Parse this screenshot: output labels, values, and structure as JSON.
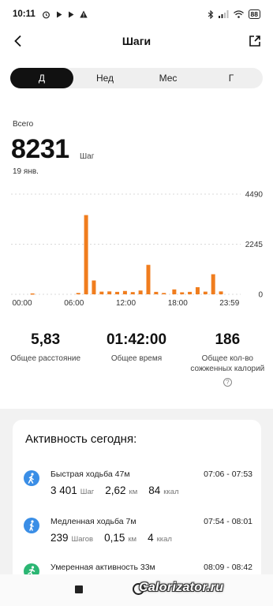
{
  "status_bar": {
    "time": "10:11",
    "battery": "88"
  },
  "header": {
    "title": "Шаги"
  },
  "tabs": [
    {
      "label": "Д",
      "active": true
    },
    {
      "label": "Нед",
      "active": false
    },
    {
      "label": "Мес",
      "active": false
    },
    {
      "label": "Г",
      "active": false
    }
  ],
  "summary": {
    "label": "Всего",
    "value": "8231",
    "unit": "Шаг",
    "date": "19 янв."
  },
  "chart_data": {
    "type": "bar",
    "x_ticks": [
      "00:00",
      "06:00",
      "12:00",
      "18:00",
      "23:59"
    ],
    "y_ticks": [
      "4490",
      "2245",
      "0"
    ],
    "ylim": [
      0,
      4490
    ],
    "bar_color": "#f07d1e",
    "bars": [
      {
        "hour": 1.2,
        "value": 40
      },
      {
        "hour": 6.5,
        "value": 60
      },
      {
        "hour": 7.4,
        "value": 3550
      },
      {
        "hour": 8.3,
        "value": 620
      },
      {
        "hour": 9.2,
        "value": 120
      },
      {
        "hour": 10.1,
        "value": 130
      },
      {
        "hour": 11.0,
        "value": 110
      },
      {
        "hour": 11.9,
        "value": 150
      },
      {
        "hour": 12.8,
        "value": 100
      },
      {
        "hour": 13.7,
        "value": 170
      },
      {
        "hour": 14.6,
        "value": 1320
      },
      {
        "hour": 15.5,
        "value": 110
      },
      {
        "hour": 16.4,
        "value": 60
      },
      {
        "hour": 17.6,
        "value": 220
      },
      {
        "hour": 18.5,
        "value": 90
      },
      {
        "hour": 19.4,
        "value": 110
      },
      {
        "hour": 20.3,
        "value": 320
      },
      {
        "hour": 21.2,
        "value": 120
      },
      {
        "hour": 22.1,
        "value": 900
      },
      {
        "hour": 23.0,
        "value": 130
      }
    ]
  },
  "stats": [
    {
      "value": "5,83",
      "label": "Общее расстояние"
    },
    {
      "value": "01:42:00",
      "label": "Общее время"
    },
    {
      "value": "186",
      "label": "Общее кол-во сожженных калорий"
    }
  ],
  "activity": {
    "title": "Активность сегодня:",
    "items": [
      {
        "icon": "walk-icon",
        "color": "#3a8ee6",
        "name": "Быстрая ходьба 47м",
        "time": "07:06 - 07:53",
        "steps": "3 401",
        "steps_unit": "Шаг",
        "distance": "2,62",
        "distance_unit": "км",
        "kcal": "84",
        "kcal_unit": "ккал"
      },
      {
        "icon": "walk-icon",
        "color": "#3a8ee6",
        "name": "Медленная ходьба 7м",
        "time": "07:54 - 08:01",
        "steps": "239",
        "steps_unit": "Шагов",
        "distance": "0,15",
        "distance_unit": "км",
        "kcal": "4",
        "kcal_unit": "ккал"
      },
      {
        "icon": "run-icon",
        "color": "#2bb673",
        "name": "Умеренная активность 33м",
        "time": "08:09 - 08:42"
      }
    ]
  },
  "watermark": "Calorizator.ru"
}
